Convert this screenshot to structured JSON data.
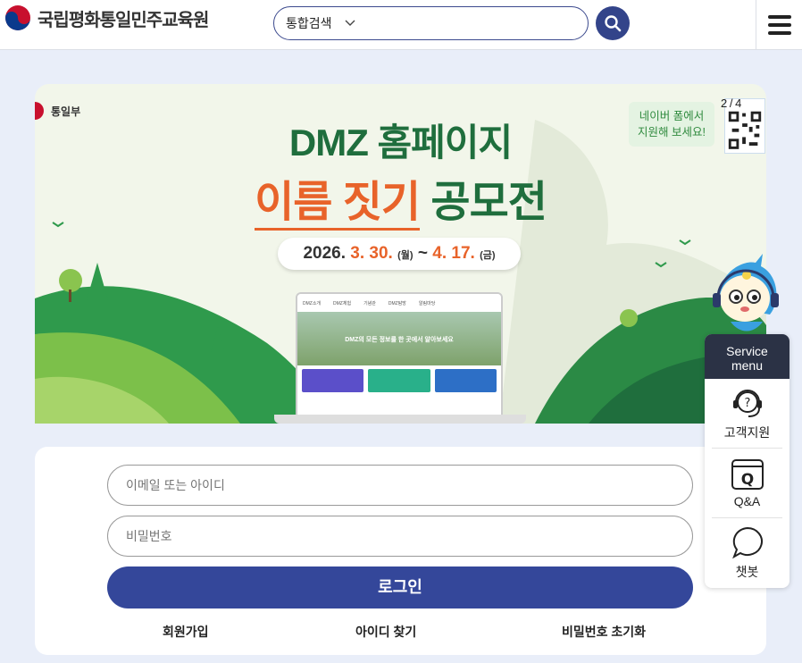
{
  "header": {
    "site_title": "국립평화통일민주교육원",
    "search_scope": "통합검색",
    "search_placeholder": "",
    "icons": {
      "search": "search-icon",
      "menu": "hamburger-menu-icon",
      "logo": "taegeuk-logo-icon"
    }
  },
  "banner": {
    "ministry": "통일부",
    "title_line1": "DMZ 홈페이지",
    "title_highlight": "이름 짓기",
    "title_rest": "공모전",
    "date_year": "2026.",
    "date_start": "3. 30.",
    "date_start_day": "(월)",
    "date_sep": "~",
    "date_end": "4. 17.",
    "date_end_day": "(금)",
    "naver_line1": "네이버 폼에서",
    "naver_line2": "지원해 보세요!",
    "page_indicator": "2 / 4",
    "laptop_caption": "DMZ의 모든 정보를 한 곳에서 알아보세요",
    "laptop_nav": [
      "DMZ소개",
      "DMZ체험",
      "기념관",
      "DMZ탐방",
      "알림마당"
    ],
    "colors": {
      "green": "#1f6e3d",
      "orange": "#e8632a"
    }
  },
  "login": {
    "id_placeholder": "이메일 또는 아이디",
    "pw_placeholder": "비밀번호",
    "login_label": "로그인",
    "signup_label": "회원가입",
    "find_id_label": "아이디 찾기",
    "reset_pw_label": "비밀번호 초기화",
    "accent": "#34479a"
  },
  "service_menu": {
    "title_line1": "Service",
    "title_line2": "menu",
    "items": [
      {
        "label": "고객지원",
        "icon": "headset-icon"
      },
      {
        "label": "Q&A",
        "icon": "qa-icon"
      },
      {
        "label": "챗봇",
        "icon": "chat-bubble-icon"
      }
    ]
  }
}
